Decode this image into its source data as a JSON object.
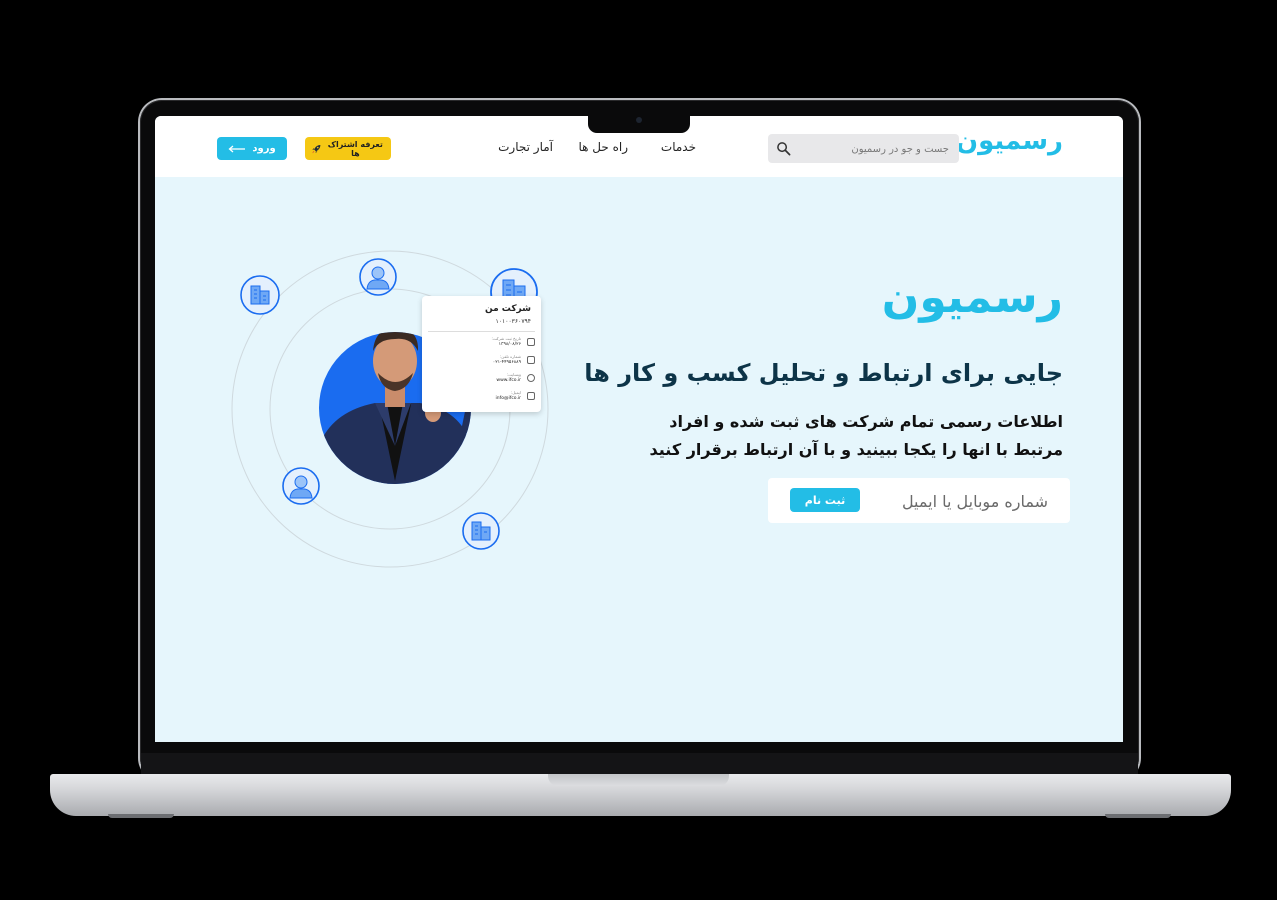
{
  "header": {
    "logo": "رسمیون",
    "search_placeholder": "جست و جو در رسمیون",
    "nav": [
      "خدمات",
      "راه حل ها",
      "آمار تجارت"
    ],
    "pricing_label": "تعرفه اشتراک ها",
    "login_label": "ورود"
  },
  "hero": {
    "title": "رسمیون",
    "subtitle": "جایی برای ارتباط و تحلیل کسب و کار ها",
    "description": "اطلاعات رسمی تمام شرکت های ثبت شده و افراد مرتبط با انها را یکجا ببینید و با آن ارتباط برقرار کنید",
    "signup_placeholder": "شماره موبایل یا ایمیل",
    "signup_button": "ثبت نام"
  },
  "card": {
    "title": "شرکت من",
    "code": "۱۰۱۰۰۳۶۰۷۹۴",
    "rows": [
      {
        "label": "تاریخ ثبت شرکت:",
        "value": "۱۳۹۸/۰۸/۲۶"
      },
      {
        "label": "شماره تلفن:",
        "value": "۰۲۱-۴۴۹۵۶۸۸۹"
      },
      {
        "label": "وبسایت:",
        "value": "www.ifco.ir"
      },
      {
        "label": "ایمیل:",
        "value": "info@ifco.ir"
      }
    ]
  },
  "colors": {
    "accent": "#23bde6",
    "hero_bg": "#e6f6fc",
    "pricing": "#f5c814",
    "title_dark": "#0d3448",
    "illustration_blue": "#1a6cf0"
  }
}
